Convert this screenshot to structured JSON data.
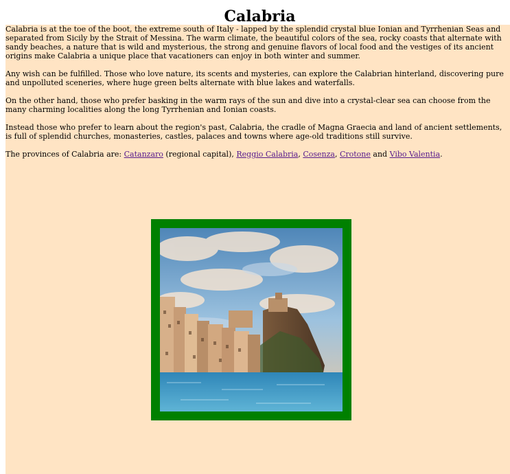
{
  "title": "Calabria",
  "paragraphs": {
    "p1": "Calabria is at the toe of the boot, the extreme south of Italy - lapped by the splendid crystal blue Ionian and Tyrrhenian Seas and separated from Sicily by the Strait of Messina. The warm climate, the beautiful colors of the sea, rocky coasts that alternate with sandy beaches, a nature that is wild and mysterious, the strong and genuine flavors of local food and the vestiges of its ancient origins make Calabria a unique place that vacationers can enjoy in both winter and summer.",
    "p2": "Any wish can be fulfilled. Those who love nature, its scents and mysteries, can explore the Calabrian hinterland, discovering pure and unpolluted sceneries, where huge green belts alternate with blue lakes and waterfalls.",
    "p3": "On the other hand, those who prefer basking in the warm rays of the sun and dive into a crystal-clear sea can choose from the many charming localities along the long Tyrrhenian and Ionian coasts.",
    "p4": "Instead those who prefer to learn about the region's past, Calabria, the cradle of Magna Graecia and land of ancient settlements, is full of splendid churches, monasteries, castles, palaces and towns where age-old traditions still survive."
  },
  "provinces": {
    "intro": "The provinces of Calabria are: ",
    "catanzaro": "Catanzaro",
    "capital_note": " (regional capital), ",
    "reggio": "Reggio Calabria",
    "sep1": ", ",
    "cosenza": "Cosenza",
    "sep2": ", ",
    "crotone": "Crotone",
    "and": " and ",
    "vibo": "Vibo Valentia",
    "end": "."
  },
  "colors": {
    "page_background": "#ffe4c4",
    "frame": "#008000",
    "link": "#551a8b"
  }
}
